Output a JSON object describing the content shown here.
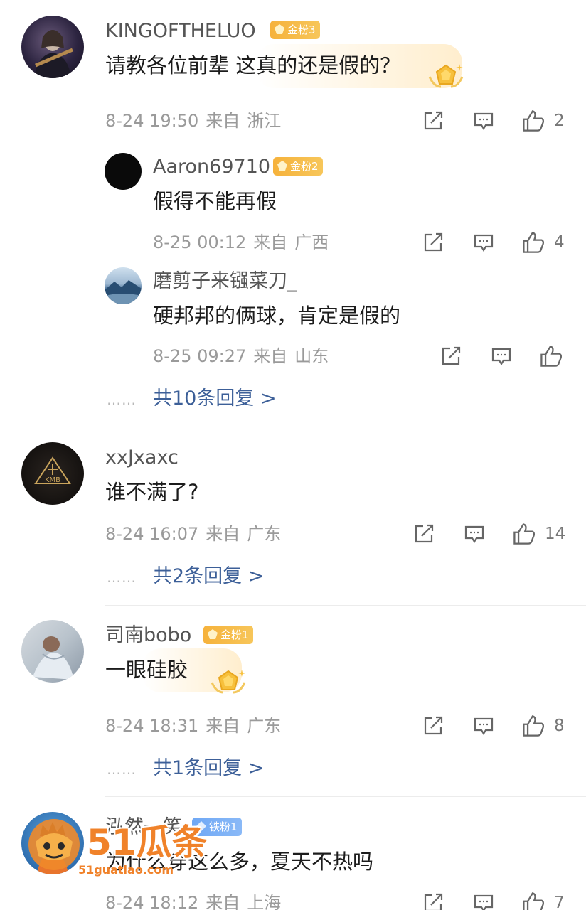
{
  "comments": [
    {
      "user": "KINGOFTHELUO",
      "badge": "金粉3",
      "text": "请教各位前辈 这真的还是假的？",
      "date": "8-24 19:50",
      "from": "来自",
      "location": "浙江",
      "likes": "2",
      "replies": [
        {
          "user": "Aaron69710",
          "badge": "金粉2",
          "text": "假得不能再假",
          "date": "8-25 00:12",
          "from": "来自",
          "location": "广西",
          "likes": "4"
        },
        {
          "user": "磨剪子来镪菜刀_",
          "text": "硬邦邦的俩球，肯定是假的",
          "date": "8-25 09:27",
          "from": "来自",
          "location": "山东"
        }
      ],
      "more_replies": "共10条回复 >"
    },
    {
      "user": "xxJxaxc",
      "text": "谁不满了?",
      "date": "8-24 16:07",
      "from": "来自",
      "location": "广东",
      "likes": "14",
      "more_replies": "共2条回复 >"
    },
    {
      "user": "司南bobo",
      "badge": "金粉1",
      "text": "一眼硅胶",
      "date": "8-24 18:31",
      "from": "来自",
      "location": "广东",
      "likes": "8",
      "more_replies": "共1条回复 >"
    },
    {
      "user": "泓然一笑",
      "badge": "铁粉1",
      "text": "为什么穿这么多，夏天不热吗",
      "date": "8-24 18:12",
      "from": "来自",
      "location": "上海",
      "likes": "7"
    }
  ],
  "dots": "……",
  "watermark": {
    "brand": "51瓜条",
    "url": "51guatiao.com"
  },
  "colors": {
    "gold_badge": "#f6b23b",
    "iron_badge": "#6fa8f5",
    "link": "#3c5f98",
    "meta": "#9a9a9a"
  },
  "icons": [
    "share-icon",
    "comment-icon",
    "like-icon",
    "gold-badge-icon",
    "iron-badge-icon",
    "medal-icon"
  ]
}
